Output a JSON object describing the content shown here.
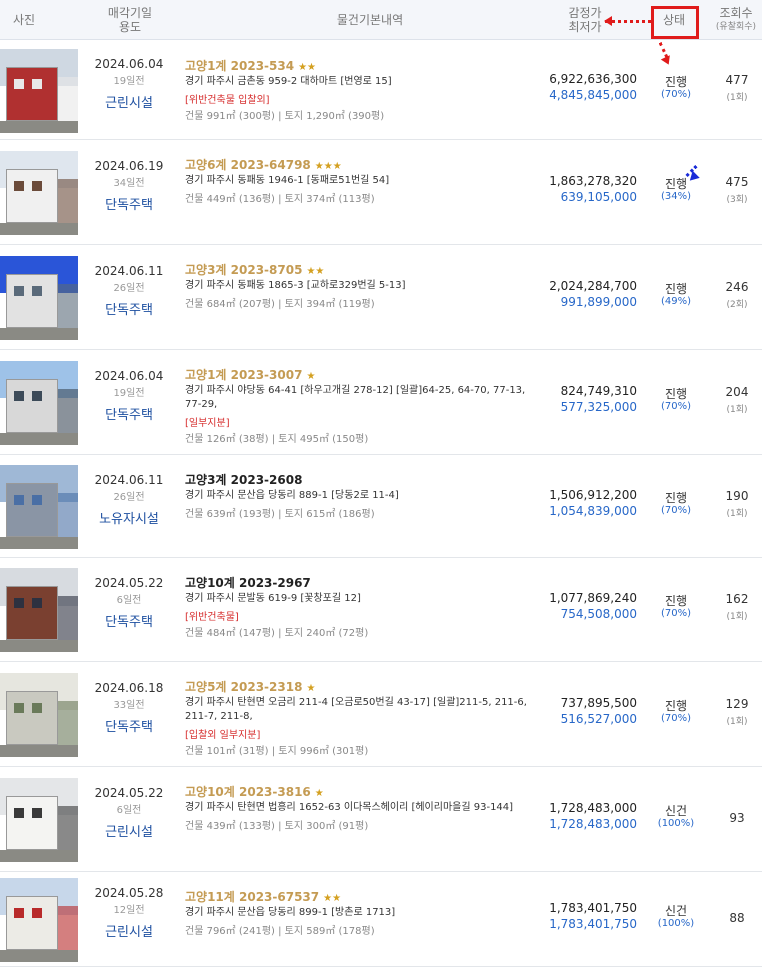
{
  "header": {
    "photo": "사진",
    "date_line1": "매각기일",
    "date_line2": "용도",
    "basic": "물건기본내역",
    "price_line1": "감정가",
    "price_line2": "최저가",
    "status": "상태",
    "views_line1": "조회수",
    "views_line2": "(유찰회수)"
  },
  "accent_colors": {
    "annotation_red": "#e01b1b",
    "annotation_blue": "#1a2bd8",
    "case_gold": "#c49b53",
    "price_blue": "#2767c8",
    "usage_blue": "#1d4fa0"
  },
  "listings": [
    {
      "date": "2024.06.04",
      "days": "19일전",
      "usage": "근린시설",
      "case": "고양1계 2023-534",
      "stars": "★★",
      "addr": "경기 파주시 금촌동 959-2 대하마트 [번영로 15]",
      "warn": "[위반건축물  입찰외]",
      "area": "건물 991㎡ (300평)  |  토지 1,290㎡ (390평)",
      "appraisal": "6,922,636,300",
      "min": "4,845,845,000",
      "status": "진행",
      "ratio": "(70%)",
      "views": "477",
      "fails": "(1회)"
    },
    {
      "date": "2024.06.19",
      "days": "34일전",
      "usage": "단독주택",
      "case": "고양6계 2023-64798",
      "stars": "★★★",
      "addr": "경기 파주시 동패동 1946-1 [동패로51번길 54]",
      "warn": "",
      "area": "건물 449㎡ (136평)  |  토지 374㎡ (113평)",
      "appraisal": "1,863,278,320",
      "min": "639,105,000",
      "status": "진행",
      "ratio": "(34%)",
      "views": "475",
      "fails": "(3회)"
    },
    {
      "date": "2024.06.11",
      "days": "26일전",
      "usage": "단독주택",
      "case": "고양3계 2023-8705",
      "stars": "★★",
      "addr": "경기 파주시 동패동 1865-3 [교하로329번길 5-13]",
      "warn": "",
      "area": "건물 684㎡ (207평)  |  토지 394㎡ (119평)",
      "appraisal": "2,024,284,700",
      "min": "991,899,000",
      "status": "진행",
      "ratio": "(49%)",
      "views": "246",
      "fails": "(2회)"
    },
    {
      "date": "2024.06.04",
      "days": "19일전",
      "usage": "단독주택",
      "case": "고양1계 2023-3007",
      "stars": "★",
      "addr": "경기 파주시 야당동 64-41 [하우고개길 278-12]  [일괄]64-25, 64-70, 77-13, 77-29,",
      "warn": "[일부지분]",
      "area": "건물 126㎡ (38평)  |  토지 495㎡ (150평)",
      "appraisal": "824,749,310",
      "min": "577,325,000",
      "status": "진행",
      "ratio": "(70%)",
      "views": "204",
      "fails": "(1회)"
    },
    {
      "date": "2024.06.11",
      "days": "26일전",
      "usage": "노유자시설",
      "case": "고양3계 2023-2608",
      "stars": "",
      "addr": "경기 파주시 문산읍 당동리 889-1 [당동2로 11-4]",
      "warn": "",
      "area": "건물 639㎡ (193평)  |  토지 615㎡ (186평)",
      "appraisal": "1,506,912,200",
      "min": "1,054,839,000",
      "status": "진행",
      "ratio": "(70%)",
      "views": "190",
      "fails": "(1회)"
    },
    {
      "date": "2024.05.22",
      "days": "6일전",
      "usage": "단독주택",
      "case": "고양10계 2023-2967",
      "stars": "",
      "addr": "경기 파주시 문발동 619-9 [꽃창포길 12]",
      "warn": "[위반건축물]",
      "area": "건물 484㎡ (147평)  |  토지 240㎡ (72평)",
      "appraisal": "1,077,869,240",
      "min": "754,508,000",
      "status": "진행",
      "ratio": "(70%)",
      "views": "162",
      "fails": "(1회)"
    },
    {
      "date": "2024.06.18",
      "days": "33일전",
      "usage": "단독주택",
      "case": "고양5계 2023-2318",
      "stars": "★",
      "addr": "경기 파주시 탄현면 오금리 211-4 [오금로50번길 43-17]  [일괄]211-5, 211-6, 211-7, 211-8,",
      "warn": "[입찰외  일부지분]",
      "area": "건물 101㎡ (31평)  |  토지 996㎡ (301평)",
      "appraisal": "737,895,500",
      "min": "516,527,000",
      "status": "진행",
      "ratio": "(70%)",
      "views": "129",
      "fails": "(1회)"
    },
    {
      "date": "2024.05.22",
      "days": "6일전",
      "usage": "근린시설",
      "case": "고양10계 2023-3816",
      "stars": "★",
      "addr": "경기 파주시 탄현면 법흥리 1652-63 이다목스헤이리 [헤이리마을길 93-144]",
      "warn": "",
      "area": "건물 439㎡ (133평)  |  토지 300㎡ (91평)",
      "appraisal": "1,728,483,000",
      "min": "1,728,483,000",
      "status": "신건",
      "ratio": "(100%)",
      "views": "93",
      "fails": ""
    },
    {
      "date": "2024.05.28",
      "days": "12일전",
      "usage": "근린시설",
      "case": "고양11계 2023-67537",
      "stars": "★★",
      "addr": "경기 파주시 문산읍 당동리 899-1 [방촌로 1713]",
      "warn": "",
      "area": "건물 796㎡ (241평)  |  토지 589㎡ (178평)",
      "appraisal": "1,783,401,750",
      "min": "1,783,401,750",
      "status": "신건",
      "ratio": "(100%)",
      "views": "88",
      "fails": ""
    }
  ]
}
